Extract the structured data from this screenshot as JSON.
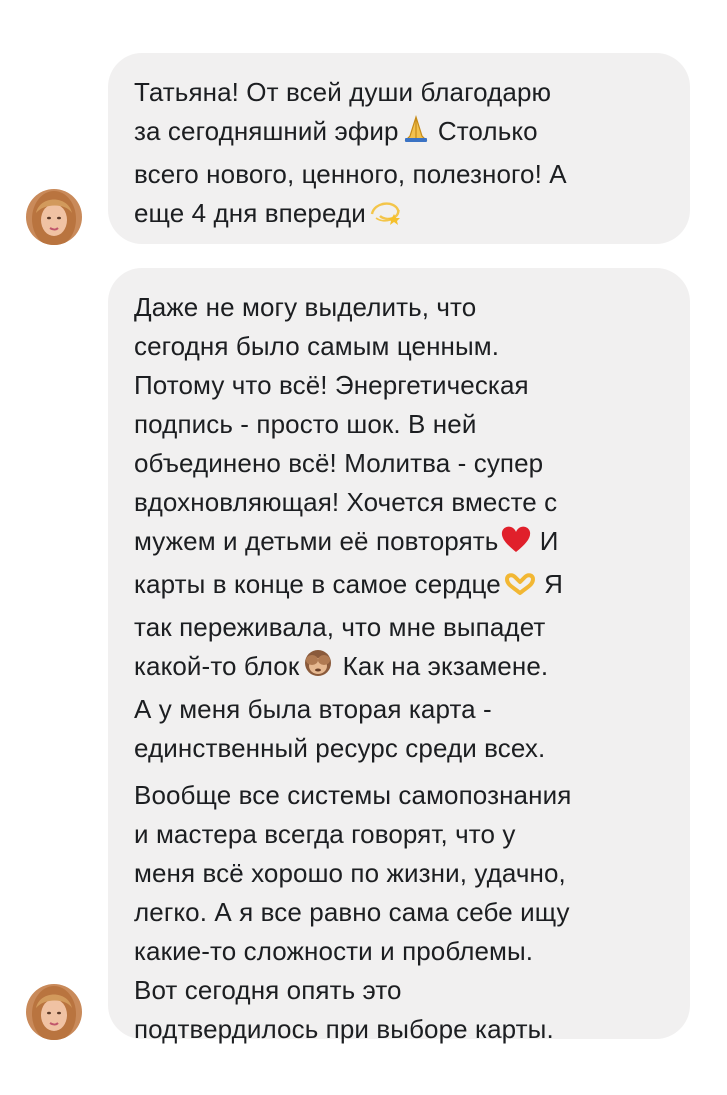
{
  "messages": [
    {
      "lines": [
        "Татьяна! От всей души  благодарю",
        "за сегодняшний эфир",
        "Столько",
        "всего нового, ценного, полезного! А",
        "еще 4 дня впереди"
      ],
      "emojis": [
        "folded-hands",
        "dizzy"
      ]
    },
    {
      "lines": [
        "Даже не могу выделить, что",
        "сегодня было самым ценным.",
        "Потому что всё! Энергетическая",
        "подпись - просто шок. В ней",
        "объединено всё! Молитва - супер",
        "вдохновляющая! Хочется вместе с",
        "мужем и детьми её повторять",
        "И",
        "карты в конце в самое сердце",
        "Я",
        "так переживала, что мне выпадет",
        "какой-то блок",
        "Как на экзамене.",
        "А у меня была вторая карта -",
        "единственный ресурс среди всех.",
        "Вообще все системы самопознания",
        "и мастера всегда говорят, что у",
        "меня всё хорошо по жизни, удачно,",
        "легко. А я все равно сама себе ищу",
        "какие-то сложности и проблемы.",
        "Вот сегодня опять это",
        "подтвердилось при выборе карты."
      ],
      "emojis": [
        "red-heart",
        "heart-hands",
        "see-no-evil-monkey"
      ]
    }
  ],
  "colors": {
    "bubble": "#f1f0f0",
    "text": "#1c1e21",
    "background": "#ffffff"
  }
}
